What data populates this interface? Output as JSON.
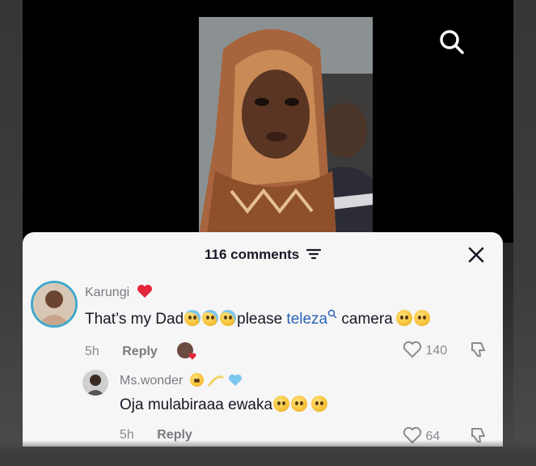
{
  "header": {
    "comment_count": "116 comments",
    "filter_icon": "filter-icon",
    "close_icon": "close-icon"
  },
  "top_bar": {
    "search_icon": "search-icon"
  },
  "comments": [
    {
      "username": "Karungi",
      "username_badge": "heart-icon",
      "text_before": "That’s my Dad",
      "text_middle": "please",
      "link_text": "teleza",
      "text_after": "camera",
      "time": "5h",
      "reply_label": "Reply",
      "likes": "140"
    },
    {
      "username": "Ms.wonder",
      "text": "Oja mulabiraaa ewaka",
      "time": "5h",
      "reply_label": "Reply",
      "likes": "64"
    }
  ],
  "colors": {
    "sheet_bg": "#f6f6f7",
    "text_primary": "#161823",
    "text_secondary": "#7a7b80",
    "link": "#2b64b5",
    "heart_red": "#e4263b",
    "avatar_ring": "#3fa9c9"
  }
}
